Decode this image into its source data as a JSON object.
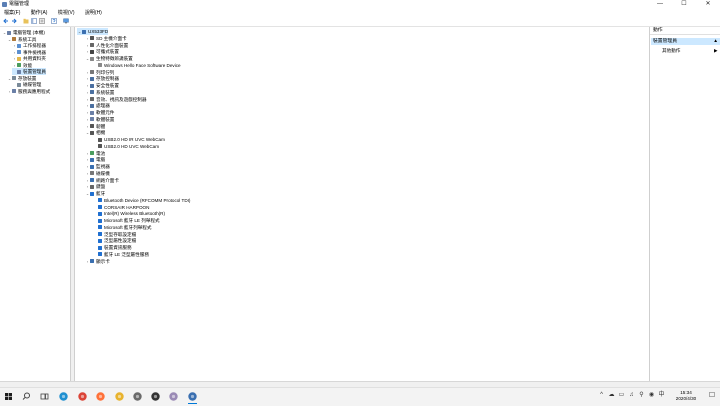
{
  "window": {
    "title": "電腦管理"
  },
  "window_buttons": {
    "minimize": "—",
    "maximize": "☐",
    "close": "✕"
  },
  "menu": [
    "檔案(F)",
    "動作(A)",
    "檢視(V)",
    "說明(H)"
  ],
  "colors": {
    "selection": "#cce8ff",
    "accent": "#0078d7"
  },
  "left_tree": [
    {
      "label": "電腦管理 (本機)",
      "depth": 0,
      "expander": "⌄",
      "icon": "computer-management-icon",
      "color": "#6a7fa6"
    },
    {
      "label": "系統工具",
      "depth": 1,
      "expander": "⌄",
      "icon": "system-tools-icon",
      "color": "#b07a3a"
    },
    {
      "label": "工作排程器",
      "depth": 2,
      "expander": "›",
      "icon": "task-scheduler-icon",
      "color": "#5b8fd0"
    },
    {
      "label": "事件檢視器",
      "depth": 2,
      "expander": "›",
      "icon": "event-viewer-icon",
      "color": "#5b8fd0"
    },
    {
      "label": "共用資料夾",
      "depth": 2,
      "expander": "›",
      "icon": "shared-folders-icon",
      "color": "#e2b84a"
    },
    {
      "label": "效能",
      "depth": 2,
      "expander": "›",
      "icon": "performance-icon",
      "color": "#4a9d5e"
    },
    {
      "label": "裝置管理員",
      "depth": 2,
      "expander": "",
      "icon": "device-manager-icon",
      "color": "#6a7fa6",
      "selected": true
    },
    {
      "label": "存放裝置",
      "depth": 1,
      "expander": "⌄",
      "icon": "storage-icon",
      "color": "#7a8a99"
    },
    {
      "label": "磁碟管理",
      "depth": 2,
      "expander": "",
      "icon": "disk-management-icon",
      "color": "#7a8a99"
    },
    {
      "label": "服務與應用程式",
      "depth": 1,
      "expander": "›",
      "icon": "services-icon",
      "color": "#6a7fa6"
    }
  ],
  "device_tree": [
    {
      "label": "UX533FD",
      "depth": 0,
      "expander": "⌄",
      "icon": "computer-icon",
      "color": "#3a6fb0",
      "selected": true
    },
    {
      "label": "SD 主機介面卡",
      "depth": 1,
      "expander": "›",
      "icon": "sd-host-icon",
      "color": "#555"
    },
    {
      "label": "人性化介面裝置",
      "depth": 1,
      "expander": "›",
      "icon": "hid-icon",
      "color": "#666"
    },
    {
      "label": "可攜式裝置",
      "depth": 1,
      "expander": "›",
      "icon": "portable-device-icon",
      "color": "#444"
    },
    {
      "label": "生物特徵辨識裝置",
      "depth": 1,
      "expander": "⌄",
      "icon": "biometric-icon",
      "color": "#888"
    },
    {
      "label": "Windows Hello Face Software Device",
      "depth": 2,
      "expander": "",
      "icon": "biometric-device-icon",
      "color": "#888"
    },
    {
      "label": "列印佇列",
      "depth": 1,
      "expander": "›",
      "icon": "print-queue-icon",
      "color": "#777"
    },
    {
      "label": "存放控制器",
      "depth": 1,
      "expander": "›",
      "icon": "storage-controller-icon",
      "color": "#4a6fa0"
    },
    {
      "label": "安全性裝置",
      "depth": 1,
      "expander": "›",
      "icon": "security-device-icon",
      "color": "#4a6fa0"
    },
    {
      "label": "系統裝置",
      "depth": 1,
      "expander": "›",
      "icon": "system-device-icon",
      "color": "#4a6fa0"
    },
    {
      "label": "音效、視訊及遊戲控制器",
      "depth": 1,
      "expander": "›",
      "icon": "sound-icon",
      "color": "#666"
    },
    {
      "label": "處理器",
      "depth": 1,
      "expander": "›",
      "icon": "processor-icon",
      "color": "#4a6fa0"
    },
    {
      "label": "軟體元件",
      "depth": 1,
      "expander": "›",
      "icon": "software-component-icon",
      "color": "#6a7fa6"
    },
    {
      "label": "軟體裝置",
      "depth": 1,
      "expander": "›",
      "icon": "software-device-icon",
      "color": "#6a7fa6"
    },
    {
      "label": "韌體",
      "depth": 1,
      "expander": "›",
      "icon": "firmware-icon",
      "color": "#555"
    },
    {
      "label": "相機",
      "depth": 1,
      "expander": "⌄",
      "icon": "camera-icon",
      "color": "#555"
    },
    {
      "label": "USB2.0 HD IR UVC WebCam",
      "depth": 2,
      "expander": "",
      "icon": "webcam-icon",
      "color": "#555"
    },
    {
      "label": "USB2.0 HD UVC WebCam",
      "depth": 2,
      "expander": "",
      "icon": "webcam-icon",
      "color": "#555"
    },
    {
      "label": "電池",
      "depth": 1,
      "expander": "›",
      "icon": "battery-icon",
      "color": "#4a9d5e"
    },
    {
      "label": "電腦",
      "depth": 1,
      "expander": "›",
      "icon": "computer-icon",
      "color": "#3a6fb0"
    },
    {
      "label": "監視器",
      "depth": 1,
      "expander": "›",
      "icon": "monitor-icon",
      "color": "#3a6fb0"
    },
    {
      "label": "磁碟機",
      "depth": 1,
      "expander": "›",
      "icon": "disk-drive-icon",
      "color": "#777"
    },
    {
      "label": "網路介面卡",
      "depth": 1,
      "expander": "›",
      "icon": "network-adapter-icon",
      "color": "#3a6fb0"
    },
    {
      "label": "鍵盤",
      "depth": 1,
      "expander": "›",
      "icon": "keyboard-icon",
      "color": "#666"
    },
    {
      "label": "藍牙",
      "depth": 1,
      "expander": "⌄",
      "icon": "bluetooth-icon",
      "color": "#1f6fd0"
    },
    {
      "label": "Bluetooth Device (RFCOMM Protocol TDI)",
      "depth": 2,
      "expander": "",
      "icon": "bluetooth-icon",
      "color": "#1f6fd0"
    },
    {
      "label": "CORSAIR HARPOON",
      "depth": 2,
      "expander": "",
      "icon": "bluetooth-icon",
      "color": "#1f6fd0"
    },
    {
      "label": "Intel(R) Wireless Bluetooth(R)",
      "depth": 2,
      "expander": "",
      "icon": "bluetooth-icon",
      "color": "#1f6fd0"
    },
    {
      "label": "Microsoft 藍牙 LE 列舉程式",
      "depth": 2,
      "expander": "",
      "icon": "bluetooth-icon",
      "color": "#1f6fd0"
    },
    {
      "label": "Microsoft 藍牙列舉程式",
      "depth": 2,
      "expander": "",
      "icon": "bluetooth-icon",
      "color": "#1f6fd0"
    },
    {
      "label": "泛型存取設定檔",
      "depth": 2,
      "expander": "",
      "icon": "bluetooth-icon",
      "color": "#1f6fd0"
    },
    {
      "label": "泛型屬性設定檔",
      "depth": 2,
      "expander": "",
      "icon": "bluetooth-icon",
      "color": "#1f6fd0"
    },
    {
      "label": "裝置資訊服務",
      "depth": 2,
      "expander": "",
      "icon": "bluetooth-icon",
      "color": "#1f6fd0"
    },
    {
      "label": "藍牙 LE 泛型屬性服務",
      "depth": 2,
      "expander": "",
      "icon": "bluetooth-icon",
      "color": "#1f6fd0"
    },
    {
      "label": "顯示卡",
      "depth": 1,
      "expander": "›",
      "icon": "display-adapter-icon",
      "color": "#3a6fb0"
    }
  ],
  "actions_pane": {
    "header": "動作",
    "section": "裝置管理員",
    "section_arrow": "▲",
    "item": "其他動作",
    "item_arrow": "▶"
  },
  "taskbar": {
    "apps": [
      {
        "name": "start-button",
        "color": "#1e1e1e"
      },
      {
        "name": "search-icon",
        "color": "#444"
      },
      {
        "name": "task-view-icon",
        "color": "#444"
      },
      {
        "name": "edge-icon",
        "color": "#1f8fd0"
      },
      {
        "name": "chrome-icon",
        "color": "#db4437"
      },
      {
        "name": "firefox-icon",
        "color": "#ff7139"
      },
      {
        "name": "file-explorer-icon",
        "color": "#e8b32e"
      },
      {
        "name": "photos-icon",
        "color": "#6a6a6a"
      },
      {
        "name": "settings-icon",
        "color": "#333"
      },
      {
        "name": "app-icon",
        "color": "#9a8ab5"
      },
      {
        "name": "computer-management-icon",
        "color": "#3a6fb0"
      }
    ],
    "tray_icons": [
      "^",
      "☁",
      "▭",
      "♫",
      "⚲",
      "◉",
      "中"
    ],
    "clock_time": "15:34",
    "clock_date": "2020/4/30",
    "notification": "☐"
  }
}
